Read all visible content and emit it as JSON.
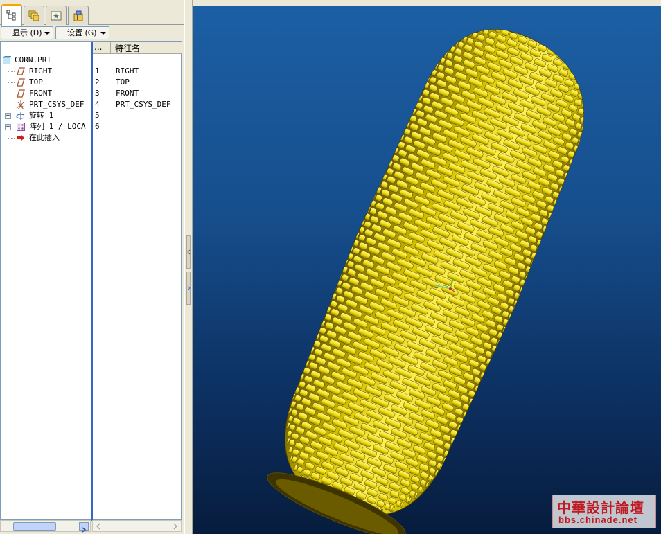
{
  "tabs": [
    {
      "icon": "model-tree-icon",
      "active": true
    },
    {
      "icon": "layers-icon",
      "active": false
    },
    {
      "icon": "favorites-icon",
      "active": false
    },
    {
      "icon": "tools-icon",
      "active": false
    }
  ],
  "toolbar": {
    "show_label": "显示 (D)",
    "settings_label": "设置 (G)"
  },
  "columns": {
    "col1": "...",
    "col2": "特征名"
  },
  "tree": [
    {
      "label": "CORN.PRT",
      "num": "",
      "name": "",
      "icon": "part-icon"
    },
    {
      "label": "RIGHT",
      "num": "1",
      "name": "RIGHT",
      "icon": "datum-plane-icon"
    },
    {
      "label": "TOP",
      "num": "2",
      "name": "TOP",
      "icon": "datum-plane-icon"
    },
    {
      "label": "FRONT",
      "num": "3",
      "name": "FRONT",
      "icon": "datum-plane-icon"
    },
    {
      "label": "PRT_CSYS_DEF",
      "num": "4",
      "name": "PRT_CSYS_DEF",
      "icon": "csys-icon"
    },
    {
      "label": "旋转 1",
      "num": "5",
      "name": "",
      "icon": "revolve-icon"
    },
    {
      "label": "阵列 1 / LOCA",
      "num": "6",
      "name": "",
      "icon": "pattern-icon"
    },
    {
      "label": "在此插入",
      "num": "",
      "name": "",
      "icon": "insert-here-icon"
    }
  ],
  "watermark": {
    "title": "中華設計論壇",
    "url": "bbs.chinade.net"
  },
  "colors": {
    "viewport_top": "#1c5fa4",
    "viewport_bottom": "#071c3d",
    "model_yellow": "#f2e10a",
    "watermark_red": "#c0191f"
  }
}
